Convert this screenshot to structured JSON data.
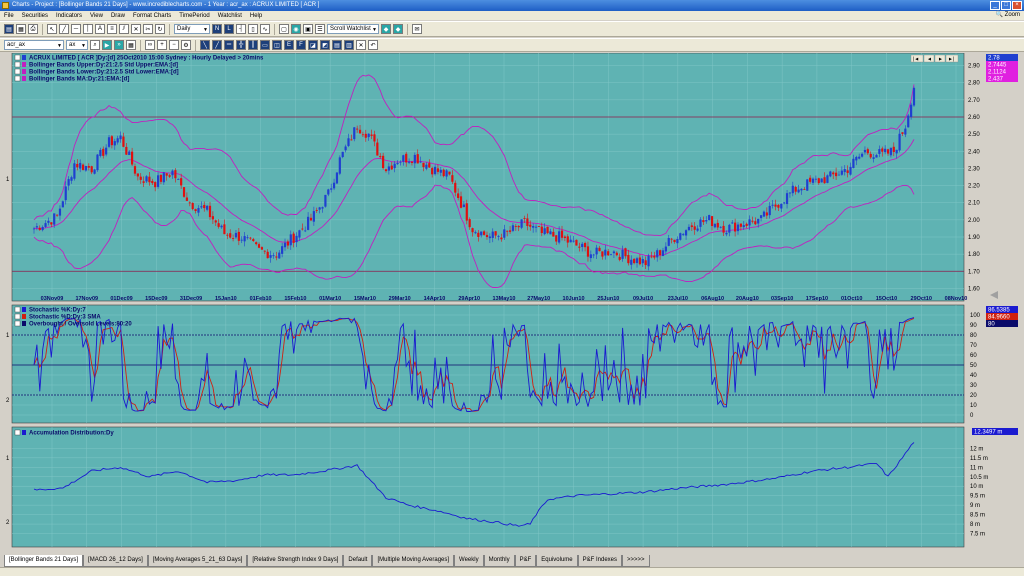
{
  "window": {
    "title": "Charts - Project : [Bollinger Bands 21 Days] - www.incrediblecharts.com - 1 Year : acr_ax : ACRUX LIMITED [ ACR ]"
  },
  "menu": [
    "File",
    "Securities",
    "Indicators",
    "View",
    "Draw",
    "Format Charts",
    "TimePeriod",
    "Watchlist",
    "Help"
  ],
  "zoom_label": "Zoom",
  "toolbar": {
    "period_select": "Daily",
    "watchlist_select": "Scroll Watchlist",
    "security_input": "acr_ax",
    "ax_select": "ax"
  },
  "colors": {
    "panel_bg": "#5fb3b3",
    "grid": "#7fc6c6",
    "up_candle": "#1f3fd0",
    "down_candle": "#e01010",
    "bands": "#c020c0",
    "stoch_k": "#1a1ad0",
    "stoch_d": "#d02010",
    "levels": "#0a0a6a",
    "hline": "#8b1a4a"
  },
  "price_panel": {
    "legend": [
      "ACRUX LIMITED [ ACR ]Dy:[d]  25Oct2010 15:00 Sydney : Hourly Delayed > 20mins",
      "Bollinger Bands Upper:Dy:21:2.5 Std Upper:EMA:[d]",
      "Bollinger Bands Lower:Dy:21:2.5 Std Lower:EMA:[d]",
      "Bollinger Bands MA:Dy:21:EMA:[d]"
    ],
    "scale_badges": [
      "2.78",
      "2.7445",
      "2.1124",
      "2.437"
    ],
    "side_label": "1",
    "nav_buttons": [
      "|◄",
      "◄",
      "►",
      "►|"
    ]
  },
  "stoch_panel": {
    "legend": [
      "Stochastic %K:Dy:7",
      "Stochastic %D:Dy:3 SMA",
      "Overbought / Oversold Levels:80:20"
    ],
    "scale_badges": [
      "86.5385",
      "84.9660",
      "80"
    ],
    "side_labels": [
      "1",
      "2"
    ]
  },
  "ad_panel": {
    "legend": [
      "Accumulation Distribution:Dy"
    ],
    "scale_badges": [
      "12.3497 m"
    ],
    "side_labels": [
      "1",
      "2"
    ]
  },
  "chart_data": [
    {
      "type": "candlestick",
      "title": "ACRUX LIMITED [ ACR ]",
      "ylim": [
        1.55,
        2.95
      ],
      "yticks": [
        "2.90",
        "2.80",
        "2.70",
        "2.60",
        "2.50",
        "2.40",
        "2.30",
        "2.20",
        "2.10",
        "2.00",
        "1.90",
        "1.80",
        "1.70",
        "1.60"
      ],
      "x_labels": [
        "03Nov09",
        "17Nov09",
        "01Dec09",
        "15Dec09",
        "31Dec09",
        "15Jan10",
        "01Feb10",
        "15Feb10",
        "01Mar10",
        "15Mar10",
        "29Mar10",
        "14Apr10",
        "29Apr10",
        "13May10",
        "27May10",
        "10Jun10",
        "25Jun10",
        "09Jul10",
        "23Jul10",
        "06Aug10",
        "20Aug10",
        "03Sep10",
        "17Sep10",
        "01Oct10",
        "15Oct10",
        "29Oct10",
        "08Nov10"
      ],
      "horizontal_lines": [
        2.6,
        1.7
      ],
      "close_anchors": [
        [
          0,
          1.95
        ],
        [
          8,
          2.02
        ],
        [
          14,
          2.33
        ],
        [
          20,
          2.3
        ],
        [
          26,
          2.45
        ],
        [
          30,
          2.48
        ],
        [
          36,
          2.25
        ],
        [
          42,
          2.22
        ],
        [
          48,
          2.28
        ],
        [
          54,
          2.1
        ],
        [
          60,
          2.05
        ],
        [
          66,
          1.92
        ],
        [
          72,
          1.9
        ],
        [
          78,
          1.82
        ],
        [
          84,
          1.8
        ],
        [
          90,
          1.9
        ],
        [
          96,
          2.0
        ],
        [
          102,
          2.15
        ],
        [
          106,
          2.35
        ],
        [
          112,
          2.55
        ],
        [
          116,
          2.5
        ],
        [
          122,
          2.3
        ],
        [
          126,
          2.35
        ],
        [
          132,
          2.37
        ],
        [
          138,
          2.3
        ],
        [
          144,
          2.25
        ],
        [
          148,
          2.1
        ],
        [
          152,
          1.95
        ],
        [
          158,
          1.9
        ],
        [
          164,
          1.92
        ],
        [
          170,
          1.98
        ],
        [
          176,
          1.92
        ],
        [
          182,
          1.9
        ],
        [
          188,
          1.85
        ],
        [
          194,
          1.8
        ],
        [
          200,
          1.82
        ],
        [
          206,
          1.78
        ],
        [
          212,
          1.75
        ],
        [
          216,
          1.8
        ],
        [
          222,
          1.9
        ],
        [
          228,
          1.97
        ],
        [
          234,
          2.0
        ],
        [
          240,
          1.95
        ],
        [
          246,
          1.98
        ],
        [
          252,
          2.0
        ],
        [
          258,
          2.1
        ],
        [
          264,
          2.18
        ],
        [
          270,
          2.22
        ],
        [
          276,
          2.25
        ],
        [
          282,
          2.3
        ],
        [
          288,
          2.4
        ],
        [
          294,
          2.38
        ],
        [
          298,
          2.4
        ],
        [
          302,
          2.55
        ],
        [
          305,
          2.78
        ]
      ]
    },
    {
      "type": "line",
      "title": "Stochastic",
      "ylim": [
        0,
        100
      ],
      "yticks": [
        100,
        90,
        80,
        70,
        60,
        50,
        40,
        30,
        20,
        10,
        0
      ],
      "series": [
        {
          "name": "Stochastic %K:Dy:7"
        },
        {
          "name": "Stochastic %D:Dy:3 SMA"
        }
      ],
      "levels": [
        80,
        50,
        20
      ]
    },
    {
      "type": "line",
      "title": "Accumulation Distribution",
      "ylim": [
        7.0,
        12.6
      ],
      "yticks": [
        "12 m",
        "11.5 m",
        "11 m",
        "10.5 m",
        "10 m",
        "9.5 m",
        "9 m",
        "8.5 m",
        "8 m",
        "7.5 m"
      ],
      "series": [
        {
          "name": "Accumulation Distribution:Dy",
          "anchors": [
            [
              0,
              9.8
            ],
            [
              10,
              9.9
            ],
            [
              20,
              10.8
            ],
            [
              30,
              11.0
            ],
            [
              40,
              10.5
            ],
            [
              50,
              10.8
            ],
            [
              60,
              10.2
            ],
            [
              70,
              10.3
            ],
            [
              80,
              10.6
            ],
            [
              90,
              10.6
            ],
            [
              100,
              10.8
            ],
            [
              108,
              11.0
            ],
            [
              112,
              11.1
            ],
            [
              116,
              10.4
            ],
            [
              122,
              9.4
            ],
            [
              130,
              9.0
            ],
            [
              140,
              8.7
            ],
            [
              150,
              8.3
            ],
            [
              160,
              8.1
            ],
            [
              168,
              7.9
            ],
            [
              172,
              8.0
            ],
            [
              174,
              8.5
            ],
            [
              178,
              9.3
            ],
            [
              188,
              9.5
            ],
            [
              200,
              9.6
            ],
            [
              212,
              9.7
            ],
            [
              224,
              9.9
            ],
            [
              240,
              10.1
            ],
            [
              256,
              10.4
            ],
            [
              270,
              10.8
            ],
            [
              282,
              11.0
            ],
            [
              292,
              11.2
            ],
            [
              296,
              10.5
            ],
            [
              300,
              11.3
            ],
            [
              305,
              12.35
            ]
          ]
        }
      ]
    }
  ],
  "tabs": [
    "[Bollinger Bands 21 Days]",
    "[MACD 26_12 Days]",
    "[Moving Averages 5_21_63 Days]",
    "[Relative Strength Index 9 Days]",
    "Default",
    "[Multiple Moving Averages]",
    "Weekly",
    "Monthly",
    "P&F",
    "Equivolume",
    "P&F Indexes",
    ">>>>>"
  ]
}
